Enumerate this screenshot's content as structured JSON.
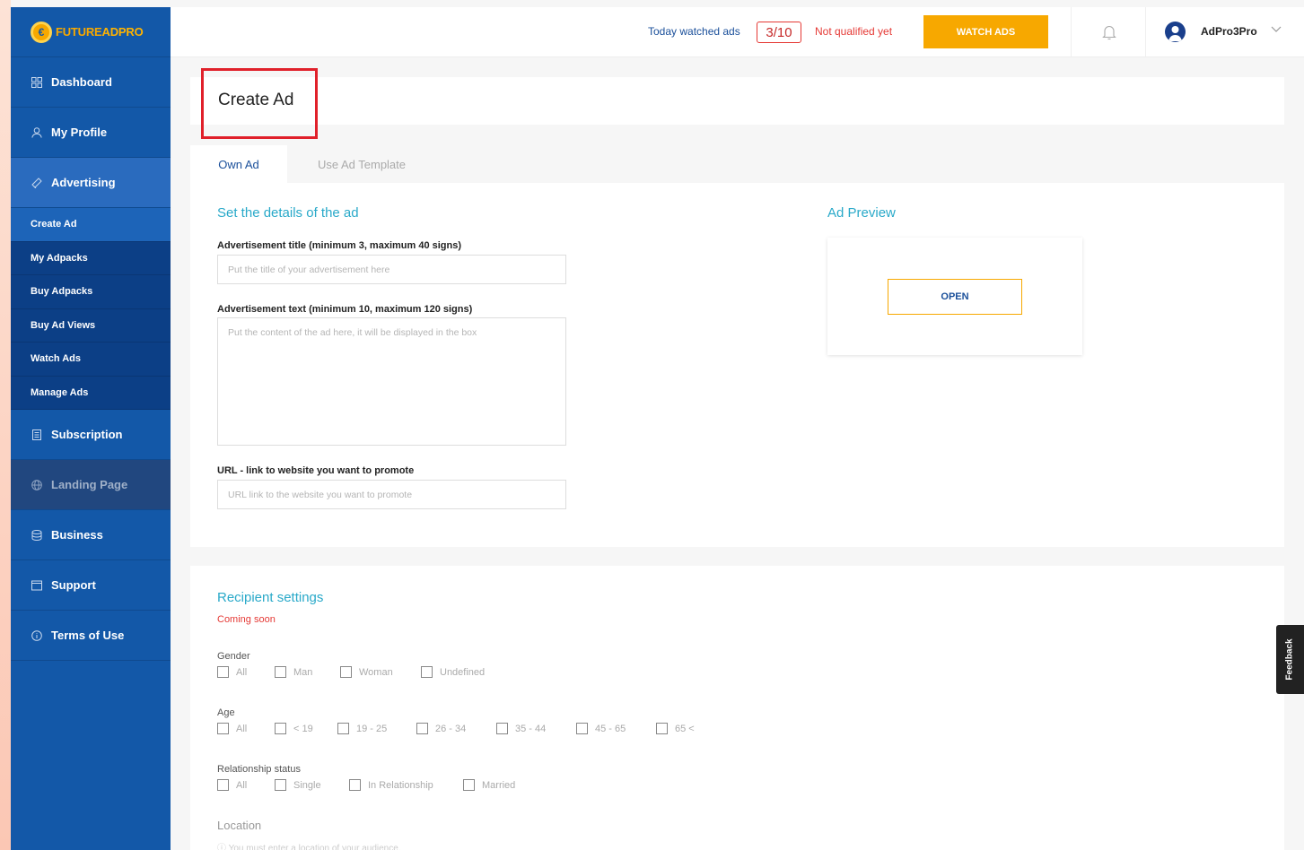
{
  "brand": {
    "logo_text_a": "FUTURE",
    "logo_text_b": "ADPRO"
  },
  "sidebar": {
    "items": [
      {
        "label": "Dashboard",
        "icon": "grid-icon"
      },
      {
        "label": "My Profile",
        "icon": "user-icon"
      },
      {
        "label": "Advertising",
        "icon": "megaphone-icon"
      }
    ],
    "sub_items": [
      "Create Ad",
      "My Adpacks",
      "Buy Adpacks",
      "Buy Ad Views",
      "Watch Ads",
      "Manage Ads"
    ],
    "items_after": [
      {
        "label": "Subscription",
        "icon": "document-icon"
      },
      {
        "label": "Landing Page",
        "icon": "globe-icon"
      },
      {
        "label": "Business",
        "icon": "database-icon"
      },
      {
        "label": "Support",
        "icon": "window-icon"
      },
      {
        "label": "Terms of Use",
        "icon": "info-icon"
      }
    ]
  },
  "topbar": {
    "watched_label": "Today watched ads",
    "watched_count": "3/10",
    "qualified_status": "Not qualified yet",
    "watch_button": "WATCH ADS",
    "username": "AdPro3Pro"
  },
  "page": {
    "title": "Create Ad",
    "tabs": [
      "Own Ad",
      "Use Ad Template"
    ]
  },
  "details": {
    "heading": "Set the details of the ad",
    "title_label": "Advertisement title (minimum 3, maximum 40 signs)",
    "title_placeholder": "Put the title of your advertisement here",
    "text_label": "Advertisement text (minimum 10, maximum 120 signs)",
    "text_placeholder": "Put the content of the ad here, it will be displayed in the box",
    "url_label": "URL - link to website you want to promote",
    "url_placeholder": "URL link to the website you want to promote"
  },
  "preview": {
    "heading": "Ad Preview",
    "open_button": "OPEN"
  },
  "recipient": {
    "heading": "Recipient settings",
    "coming_soon": "Coming soon",
    "gender_label": "Gender",
    "gender_options": [
      "All",
      "Man",
      "Woman",
      "Undefined"
    ],
    "age_label": "Age",
    "age_options": [
      "All",
      "< 19",
      "19 - 25",
      "26 - 34",
      "35 - 44",
      "45 - 65",
      "65 <"
    ],
    "relationship_label": "Relationship status",
    "relationship_options": [
      "All",
      "Single",
      "In Relationship",
      "Married"
    ],
    "location_label": "Location",
    "location_note": "ⓘ You must enter a location of your audience."
  },
  "feedback_label": "Feedback"
}
